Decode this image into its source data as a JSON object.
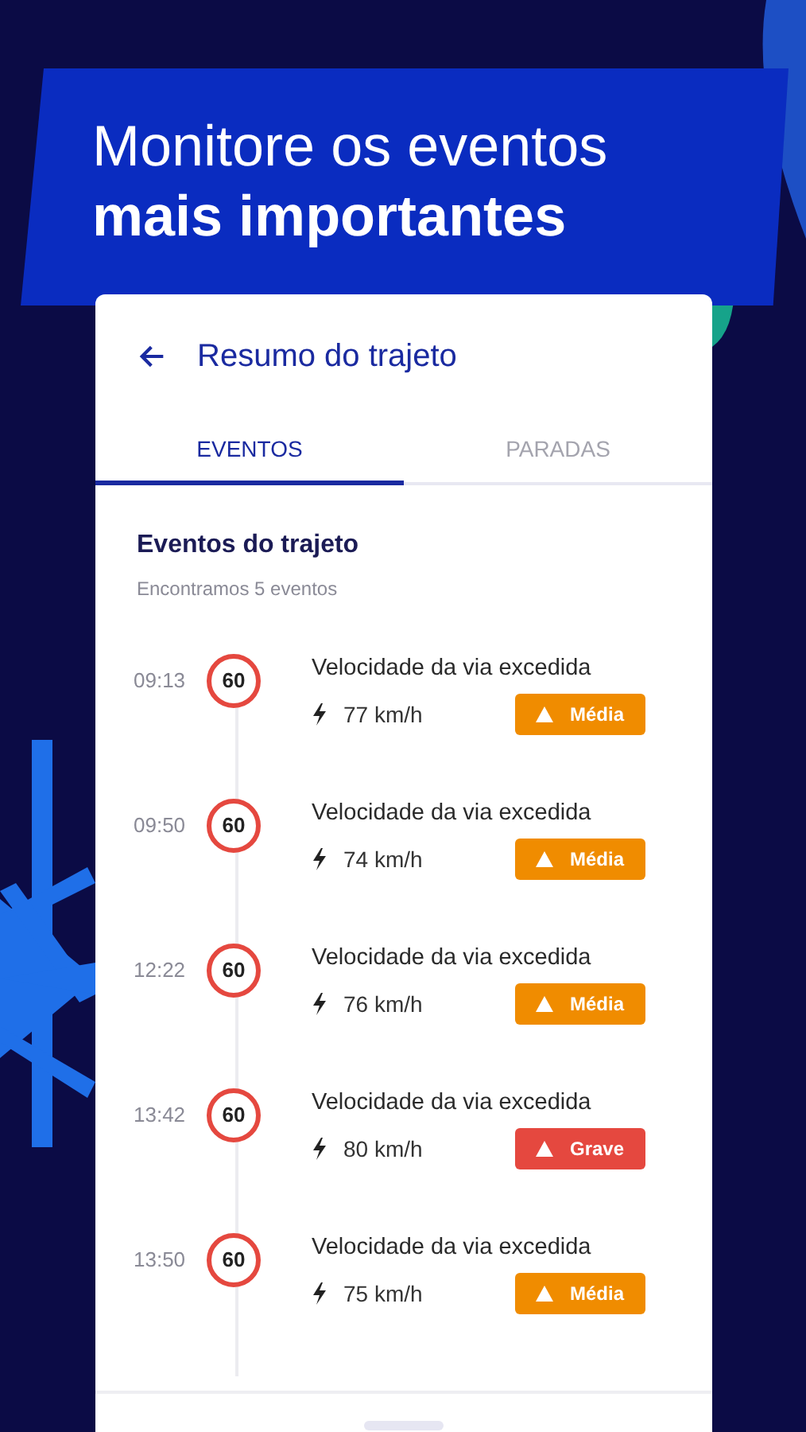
{
  "banner": {
    "line_1": "Monitore os eventos",
    "line_2": "mais importantes"
  },
  "header": {
    "title": "Resumo do trajeto"
  },
  "tabs": [
    {
      "label": "EVENTOS",
      "selected": true
    },
    {
      "label": "PARADAS",
      "selected": false
    }
  ],
  "section": {
    "title": "Eventos do trajeto",
    "subtitle": "Encontramos 5 eventos"
  },
  "events": [
    {
      "time": "09:13",
      "limit": "60",
      "title": "Velocidade da via excedida",
      "speed": "77 km/h",
      "badge": "Média",
      "color": "#f08c00"
    },
    {
      "time": "09:50",
      "limit": "60",
      "title": "Velocidade da via excedida",
      "speed": "74 km/h",
      "badge": "Média",
      "color": "#f08c00"
    },
    {
      "time": "12:22",
      "limit": "60",
      "title": "Velocidade da via excedida",
      "speed": "76 km/h",
      "badge": "Média",
      "color": "#f08c00"
    },
    {
      "time": "13:42",
      "limit": "60",
      "title": "Velocidade da via excedida",
      "speed": "80 km/h",
      "badge": "Grave",
      "color": "#e5483f"
    },
    {
      "time": "13:50",
      "limit": "60",
      "title": "Velocidade da via excedida",
      "speed": "75 km/h",
      "badge": "Média",
      "color": "#f08c00"
    }
  ]
}
